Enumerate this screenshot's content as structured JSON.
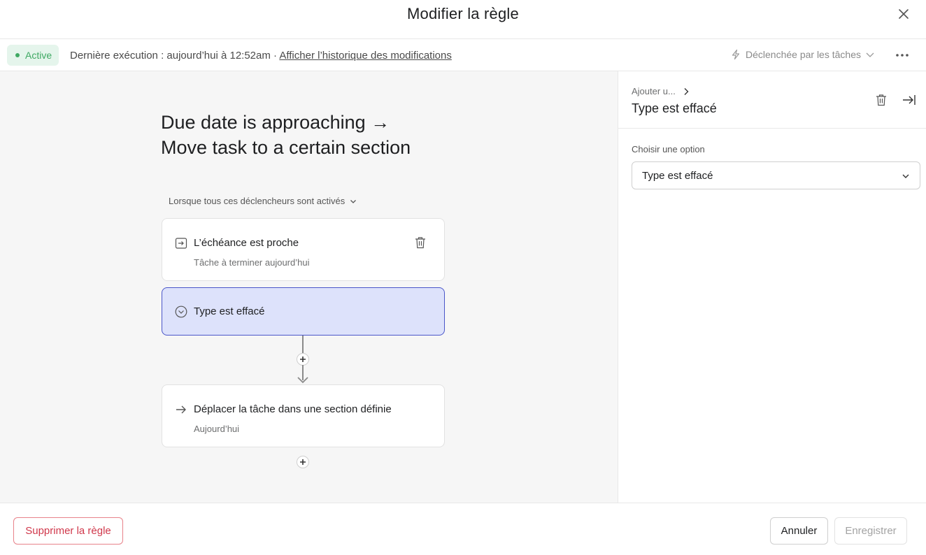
{
  "header": {
    "title": "Modifier la règle",
    "close_icon": "close-icon"
  },
  "status": {
    "badge": "Active",
    "last_run": "Dernière exécution : aujourd’hui à 12:52am · ",
    "history_link": "Afficher l’historique des modifications",
    "trigger_dropdown": "Déclenchée par les tâches",
    "more_icon": "more-horizontal-icon"
  },
  "canvas": {
    "rule_title_line1": "Due date is approaching →",
    "rule_title_line2": "Move task to a certain section",
    "when_label": "Lorsque tous ces déclencheurs sont activés",
    "trigger_card": {
      "title": "L’échéance est proche",
      "subtitle": "Tâche à terminer aujourd’hui",
      "icon": "calendar-arrow-icon"
    },
    "condition_card": {
      "title": "Type est effacé",
      "icon": "chevron-circle-icon"
    },
    "action_card": {
      "title": "Déplacer la tâche dans une section définie",
      "subtitle": "Aujourd’hui",
      "icon": "arrow-right-icon"
    }
  },
  "side_panel": {
    "breadcrumb": "Ajouter u...",
    "title": "Type est effacé",
    "option_label": "Choisir une option",
    "option_value": "Type est effacé"
  },
  "footer": {
    "delete_label": "Supprimer la règle",
    "cancel_label": "Annuler",
    "save_label": "Enregistrer"
  },
  "colors": {
    "active_badge_bg": "#e5f5ec",
    "active_green": "#3fa963",
    "selected_card_bg": "#dde2fb",
    "selected_card_border": "#4a56c9",
    "danger": "#d0384b"
  }
}
